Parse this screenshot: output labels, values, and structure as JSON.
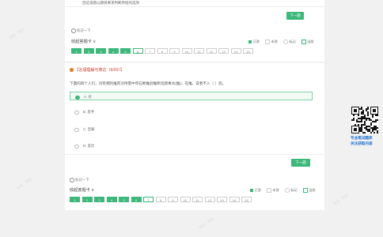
{
  "top_card": {
    "truncated_option_text": "因这道题以题目要求判断所给的选项",
    "next_label": "下一题",
    "mark_label": "标记一下",
    "answer_card_title": "收起答题卡 ∨",
    "legend": [
      "已答",
      "未答",
      "标记",
      "当前"
    ],
    "numbers": [
      "1",
      "2",
      "3",
      "4",
      "5",
      "6",
      "7",
      "8",
      "9",
      "10",
      "11",
      "12",
      "13",
      "14",
      "15"
    ],
    "answered_count": 5,
    "current": "6"
  },
  "question": {
    "type_label": "【言语理解与表达（6/20）】",
    "text": "下面的四个人们，对有相的推荐对待需中尽石断推验推断话题事太(推)、在推，说者不入（   ）后。",
    "options": [
      {
        "label": "A. 对",
        "selected": true
      },
      {
        "label": "B. 反手",
        "selected": false
      },
      {
        "label": "C. 宝翰",
        "selected": false
      },
      {
        "label": "D. 反历",
        "selected": false
      }
    ],
    "next_label": "下一题",
    "mark_label": "标记一下"
  },
  "bottom_card": {
    "answer_card_title": "收起答题卡 ∨",
    "legend": [
      "已答",
      "未答",
      "标记",
      "当前"
    ],
    "numbers": [
      "1",
      "2",
      "3",
      "4",
      "5",
      "6",
      "7",
      "8",
      "9",
      "10",
      "11",
      "12",
      "13",
      "14",
      "15"
    ],
    "answered_count": 6,
    "current": "7"
  },
  "qr_caption": [
    "专业笔试题库",
    "关注获取内容"
  ],
  "watermark": "做题 · 刷题",
  "colors": {
    "accent": "#3db77a",
    "qr_caption": "#1e6fd0",
    "background": "#f1f1f1"
  }
}
